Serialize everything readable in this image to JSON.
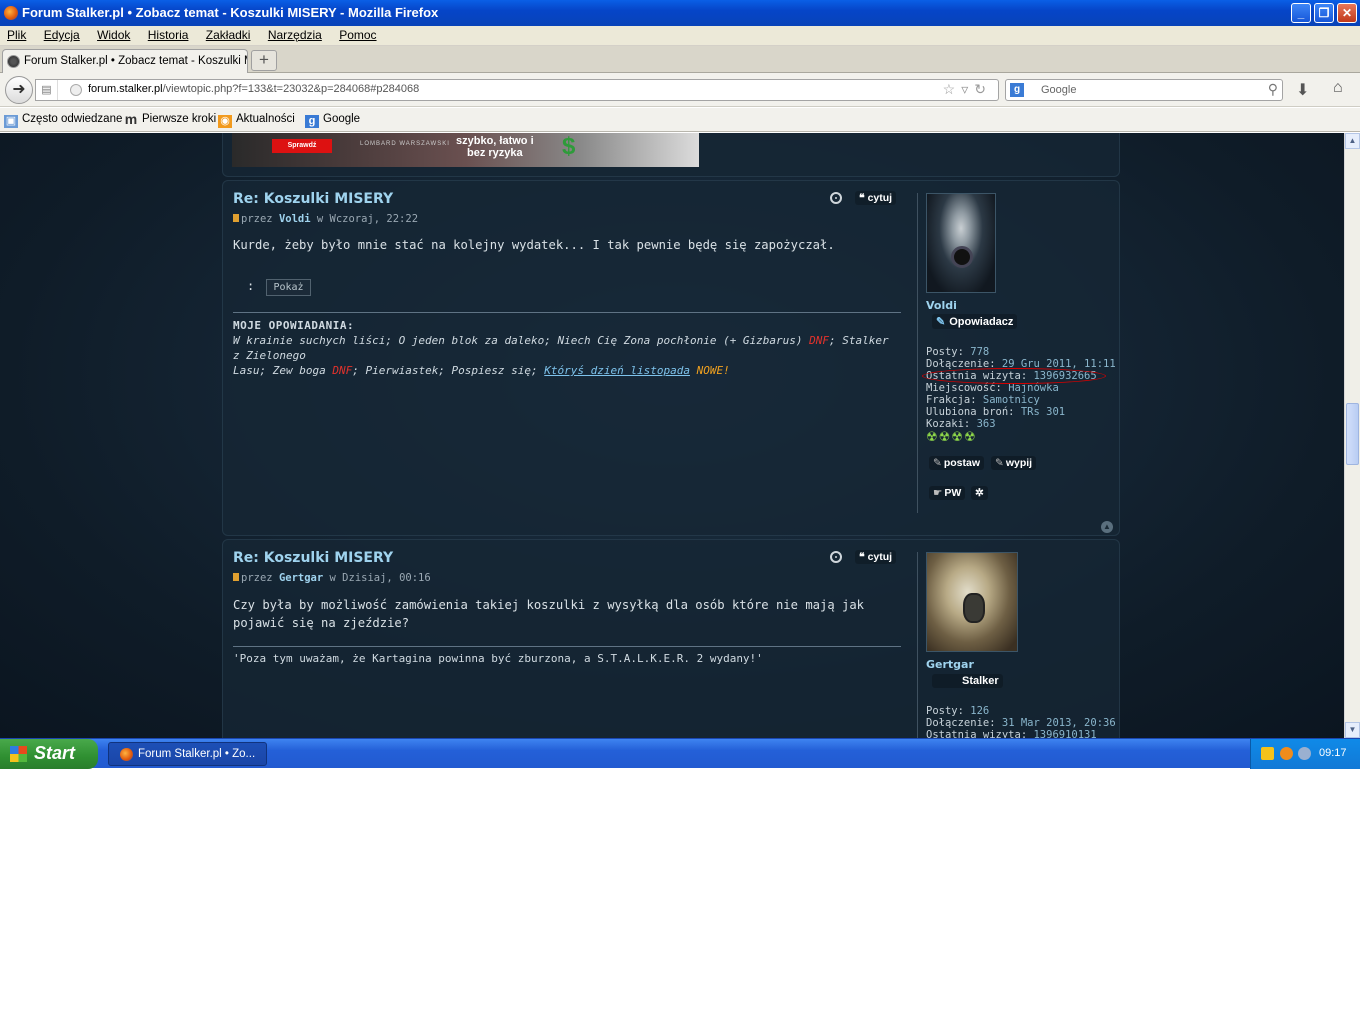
{
  "window": {
    "title": "Forum Stalker.pl • Zobacz temat - Koszulki MISERY - Mozilla Firefox",
    "minimize": "_",
    "maximize": "❐",
    "close": "✕"
  },
  "menu": [
    "Plik",
    "Edycja",
    "Widok",
    "Historia",
    "Zakładki",
    "Narzędzia",
    "Pomoc"
  ],
  "tab": {
    "label": "Forum Stalker.pl • Zobacz temat - Koszulki M...",
    "new_tab": "+"
  },
  "navbar": {
    "url_domain": "forum.stalker.pl",
    "url_path": "/viewtopic.php?f=133&t=23032&p=284068#p284068",
    "search_engine": "g",
    "search_placeholder": "Google"
  },
  "bookmarks": [
    {
      "label": "Często odwiedzane",
      "icon": "folder-icon"
    },
    {
      "label": "Pierwsze kroki",
      "icon": "m-icon"
    },
    {
      "label": "Aktualności",
      "icon": "rss-icon"
    },
    {
      "label": "Google",
      "icon": "google-icon"
    }
  ],
  "ad": {
    "button": "Sprawdź",
    "logo": "LOMBARD WARSZAWSKI",
    "slogan_1": "szybko, łatwo i",
    "slogan_2": "bez ryzyka",
    "symbol": "$"
  },
  "posts": [
    {
      "title": "Re: Koszulki MISERY",
      "meta_by": "przez",
      "author": "Voldi",
      "meta_time": "w Wczoraj, 22:22",
      "body": "Kurde, żeby było mnie stać na kolejny wydatek... I tak pewnie będę się zapożyczał.",
      "spoiler_prefix": ":",
      "spoiler_button": "Pokaż",
      "quote_button": "cytuj",
      "sig": {
        "head": "MOJE OPOWIADANIA:",
        "l1a": "W krainie suchych liści; O jeden blok za daleko; Niech Cię Zona pochłonie (+ Gizbarus) ",
        "l1b": "DNF",
        "l1c": "; Stalker z Zielonego",
        "l2a": "Lasu; Zew boga ",
        "l2b": "DNF",
        "l2c": "; Pierwiastek; Pospiesz się; ",
        "l2link": "Któryś dzień listopada",
        "l2sp": " ",
        "l2new": "NOWE!"
      },
      "user": {
        "name": "Voldi",
        "rank": "Opowiadacz",
        "posts_label": "Posty:",
        "posts": "778",
        "joined_label": "Dołączenie:",
        "joined": "29 Gru 2011, 11:11",
        "last_label": "Ostatnia wizyta:",
        "last": "1396932665",
        "city_label": "Miejscowość:",
        "city": "Hajnówka",
        "faction_label": "Frakcja:",
        "faction": "Samotnicy",
        "weapon_label": "Ulubiona broń:",
        "weapon": "TRs 301",
        "kozaki_label": "Kozaki:",
        "kozaki": "363",
        "rads": "☢☢☢☢",
        "btn_postaw": "postaw",
        "btn_wypij": "wypij",
        "btn_pw": "PW",
        "btn_web": "✲"
      }
    },
    {
      "title": "Re: Koszulki MISERY",
      "meta_by": "przez",
      "author": "Gertgar",
      "meta_time": "w Dzisiaj, 00:16",
      "body": "Czy była by możliwość zamówienia takiej koszulki z wysyłką dla osób które nie mają jak pojawić się na zjeździe?",
      "quote_button": "cytuj",
      "sig_text": "'Poza tym uważam, że Kartagina powinna być zburzona, a S.T.A.L.K.E.R. 2 wydany!'",
      "user": {
        "name": "Gertgar",
        "rank": "Stalker",
        "posts_label": "Posty:",
        "posts": "126",
        "joined_label": "Dołączenie:",
        "joined": "31 Mar 2013, 20:36",
        "last_label": "Ostatnia wizyta:",
        "last": "1396910131"
      }
    }
  ],
  "taskbar": {
    "start": "Start",
    "item": "Forum Stalker.pl • Zo...",
    "time": "09:17"
  },
  "colors": {
    "accent_link": "#9fd3ee",
    "forum_bg": "#0f1c28",
    "highlight_red": "#d40000"
  }
}
